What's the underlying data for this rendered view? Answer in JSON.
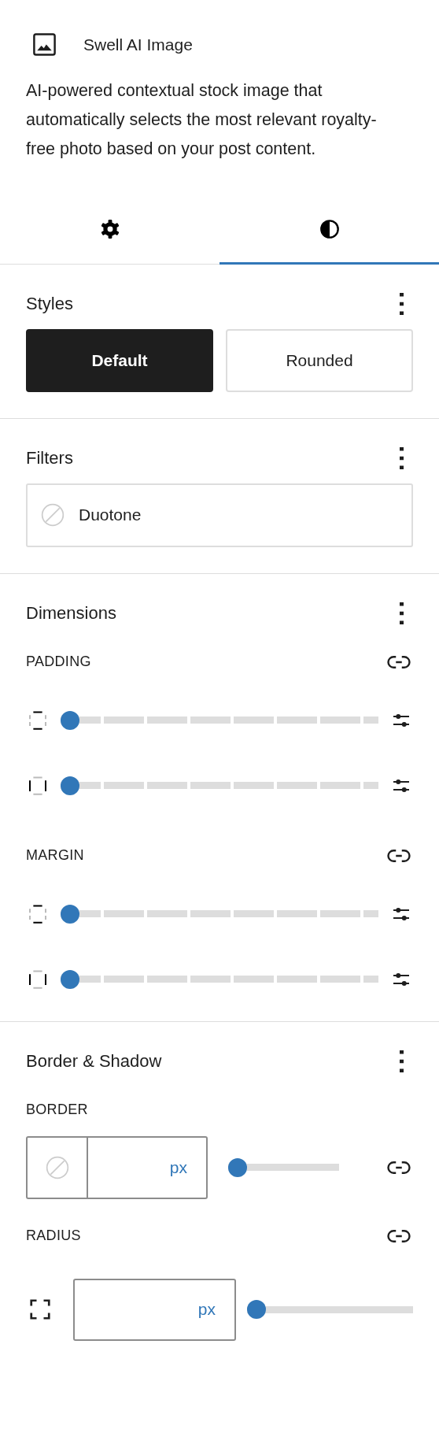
{
  "block": {
    "title": "Swell AI Image",
    "description": "AI-powered contextual stock image that automatically selects the most relevant royalty-free photo based on your post content."
  },
  "tabs": [
    {
      "kind": "settings",
      "selected": false
    },
    {
      "kind": "styles",
      "selected": true
    }
  ],
  "panels": [
    {
      "kind": "styles",
      "title": "Styles",
      "options": [
        {
          "label": "Default",
          "selected": true
        },
        {
          "label": "Rounded",
          "selected": false
        }
      ]
    },
    {
      "kind": "filters",
      "title": "Filters",
      "items": [
        {
          "label": "Duotone"
        }
      ]
    },
    {
      "kind": "dimensions",
      "title": "Dimensions",
      "groups": [
        {
          "label": "PADDING",
          "sliders": [
            {
              "kind": "vertical",
              "level": 0
            },
            {
              "kind": "horizontal",
              "level": 0
            }
          ]
        },
        {
          "label": "MARGIN",
          "sliders": [
            {
              "kind": "vertical",
              "level": 0
            },
            {
              "kind": "horizontal",
              "level": 0
            }
          ]
        }
      ]
    },
    {
      "kind": "border",
      "title": "Border & Shadow",
      "border": {
        "label": "BORDER",
        "unit": "px",
        "level": 0
      },
      "radius": {
        "label": "RADIUS",
        "unit": "px",
        "level": 0
      }
    }
  ]
}
